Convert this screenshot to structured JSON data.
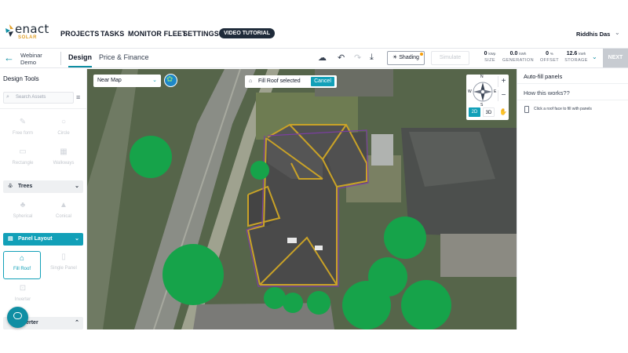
{
  "brand": {
    "name": "enact",
    "sub": "SOLAR"
  },
  "nav": {
    "projects": "PROJECTS",
    "tasks": "TASKS",
    "monitor_fleet": "MONITOR FLEET",
    "settings": "SETTINGS",
    "video_tutorial": "VIDEO TUTORIAL"
  },
  "user": {
    "name": "Riddhis Das"
  },
  "project": {
    "line1": "Webinar",
    "line2": "Demo"
  },
  "tabs": {
    "design": "Design",
    "price": "Price & Finance"
  },
  "toolbar": {
    "shading": "Shading",
    "simulate": "Simulate",
    "next": "NEXT"
  },
  "stats": {
    "size": {
      "value": "0",
      "unit": "kWp",
      "label": "SIZE"
    },
    "generation": {
      "value": "0.0",
      "unit": "kWh",
      "label": "GENERATION"
    },
    "offset": {
      "value": "0",
      "unit": "%",
      "label": "OFFSET"
    },
    "storage": {
      "value": "12.6",
      "unit": "kWh",
      "label": "STORAGE"
    }
  },
  "sidebar": {
    "title": "Design Tools",
    "search_placeholder": "Search Assets",
    "tools": {
      "free_form": "Free form",
      "circle": "Circle",
      "rectangle": "Rectangle",
      "walkways": "Walkways",
      "spherical": "Spherical",
      "conical": "Conical",
      "fill_roof": "Fill Roof",
      "single_panel": "Single Panel",
      "inverter_tool": "Inverter"
    },
    "sections": {
      "trees": "Trees",
      "panel_layout": "Panel Layout",
      "inverter": "Inverter"
    }
  },
  "map": {
    "view_select": "Near Map",
    "banner": "Fill Roof selected",
    "cancel": "Cancel",
    "compass": {
      "n": "N",
      "s": "S",
      "e": "E",
      "w": "W"
    },
    "view_2d": "2D",
    "view_3d": "3D",
    "zoom_in": "+",
    "zoom_out": "−"
  },
  "right_panel": {
    "title": "Auto-fill panels",
    "how": "How this works??",
    "hint": "Click a roof face to fill with panels"
  },
  "colors": {
    "accent": "#12a0b8",
    "tree_green": "#16a34a",
    "roof_outline": "#c9a227"
  }
}
